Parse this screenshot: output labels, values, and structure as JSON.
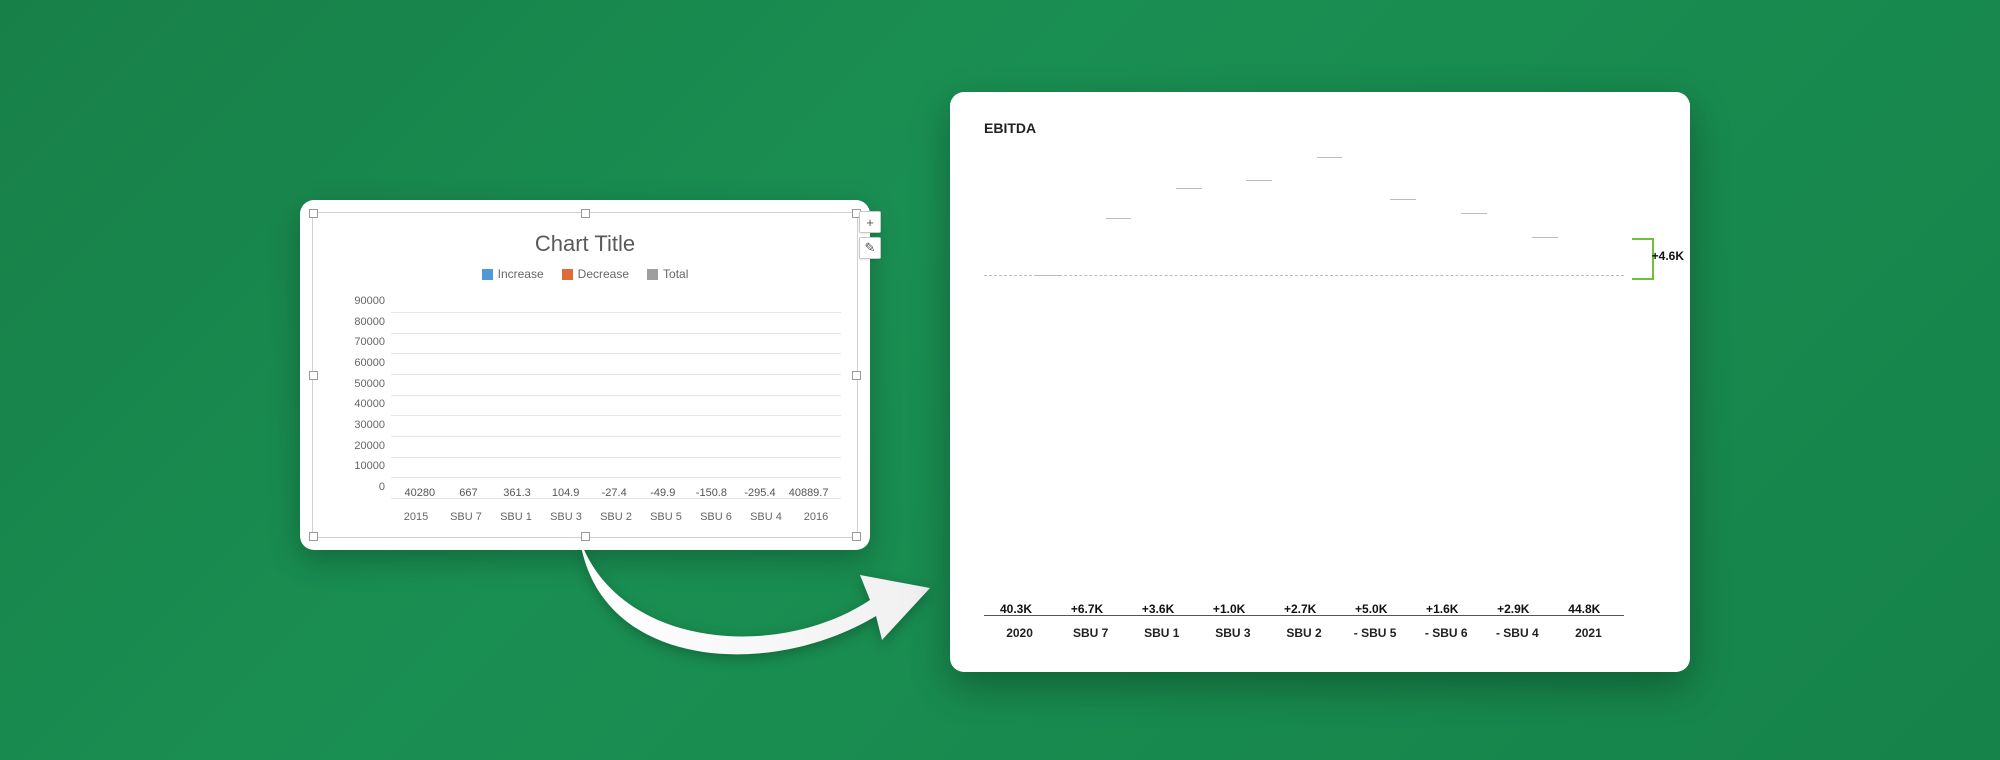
{
  "chart_data": [
    {
      "type": "bar",
      "subtype": "waterfall",
      "title": "Chart Title",
      "legend": [
        {
          "name": "Increase",
          "color": "#4e9ad6"
        },
        {
          "name": "Decrease",
          "color": "#e06b3a"
        },
        {
          "name": "Total",
          "color": "#9e9e9e"
        }
      ],
      "ylim": [
        0,
        90000
      ],
      "y_ticks": [
        0,
        10000,
        20000,
        30000,
        40000,
        50000,
        60000,
        70000,
        80000,
        90000
      ],
      "categories": [
        "2015",
        "SBU 7",
        "SBU 1",
        "SBU 3",
        "SBU 2",
        "SBU 5",
        "SBU 6",
        "SBU 4",
        "2016"
      ],
      "data_labels": [
        "40280",
        "667",
        "361.3",
        "104.9",
        "-27.4",
        "-49.9",
        "-150.8",
        "-295.4",
        "40889.7"
      ],
      "values": [
        40280,
        667,
        361.3,
        104.9,
        -27.4,
        -49.9,
        -150.8,
        -295.4,
        40889.7
      ],
      "totals_index": [
        0,
        8
      ]
    },
    {
      "type": "bar",
      "subtype": "waterfall",
      "title": "EBITDA",
      "categories": [
        "2020",
        "SBU 7",
        "SBU 1",
        "SBU 3",
        "SBU 2",
        "- SBU 5",
        "- SBU 6",
        "- SBU 4",
        "2021"
      ],
      "data_labels": [
        "40.3K",
        "+6.7K",
        "+3.6K",
        "+1.0K",
        "+2.7K",
        "+5.0K",
        "+1.6K",
        "+2.9K",
        "44.8K"
      ],
      "values": [
        40.3,
        6.7,
        3.6,
        1.0,
        2.7,
        -5.0,
        -1.6,
        -2.9,
        44.8
      ],
      "totals_index": [
        0,
        8
      ],
      "delta_label": "+4.6K",
      "colors": {
        "total": "#3c3c3c",
        "increase": "#70c040",
        "decrease": "#e23c2c"
      },
      "ylim": [
        0,
        55
      ]
    }
  ],
  "left": {
    "title": "Chart Title",
    "legend": {
      "increase": "Increase",
      "decrease": "Decrease",
      "total": "Total"
    },
    "y_ticks": [
      "0",
      "10000",
      "20000",
      "30000",
      "40000",
      "50000",
      "60000",
      "70000",
      "80000",
      "90000"
    ],
    "x_ticks": [
      "2015",
      "SBU 7",
      "SBU 1",
      "SBU 3",
      "SBU 2",
      "SBU 5",
      "SBU 6",
      "SBU 4",
      "2016"
    ],
    "labels": [
      "40280",
      "667",
      "361.3",
      "104.9",
      "-27.4",
      "-49.9",
      "-150.8",
      "-295.4",
      "40889.7"
    ],
    "side_btn_plus": "+",
    "side_btn_edit": "✎"
  },
  "right": {
    "title": "EBITDA",
    "x_ticks": [
      "2020",
      "SBU 7",
      "SBU 1",
      "SBU 3",
      "SBU 2",
      "- SBU 5",
      "- SBU 6",
      "- SBU 4",
      "2021"
    ],
    "labels": [
      "40.3K",
      "+6.7K",
      "+3.6K",
      "+1.0K",
      "+2.7K",
      "+5.0K",
      "+1.6K",
      "+2.9K",
      "44.8K"
    ],
    "delta": "+4.6K"
  }
}
